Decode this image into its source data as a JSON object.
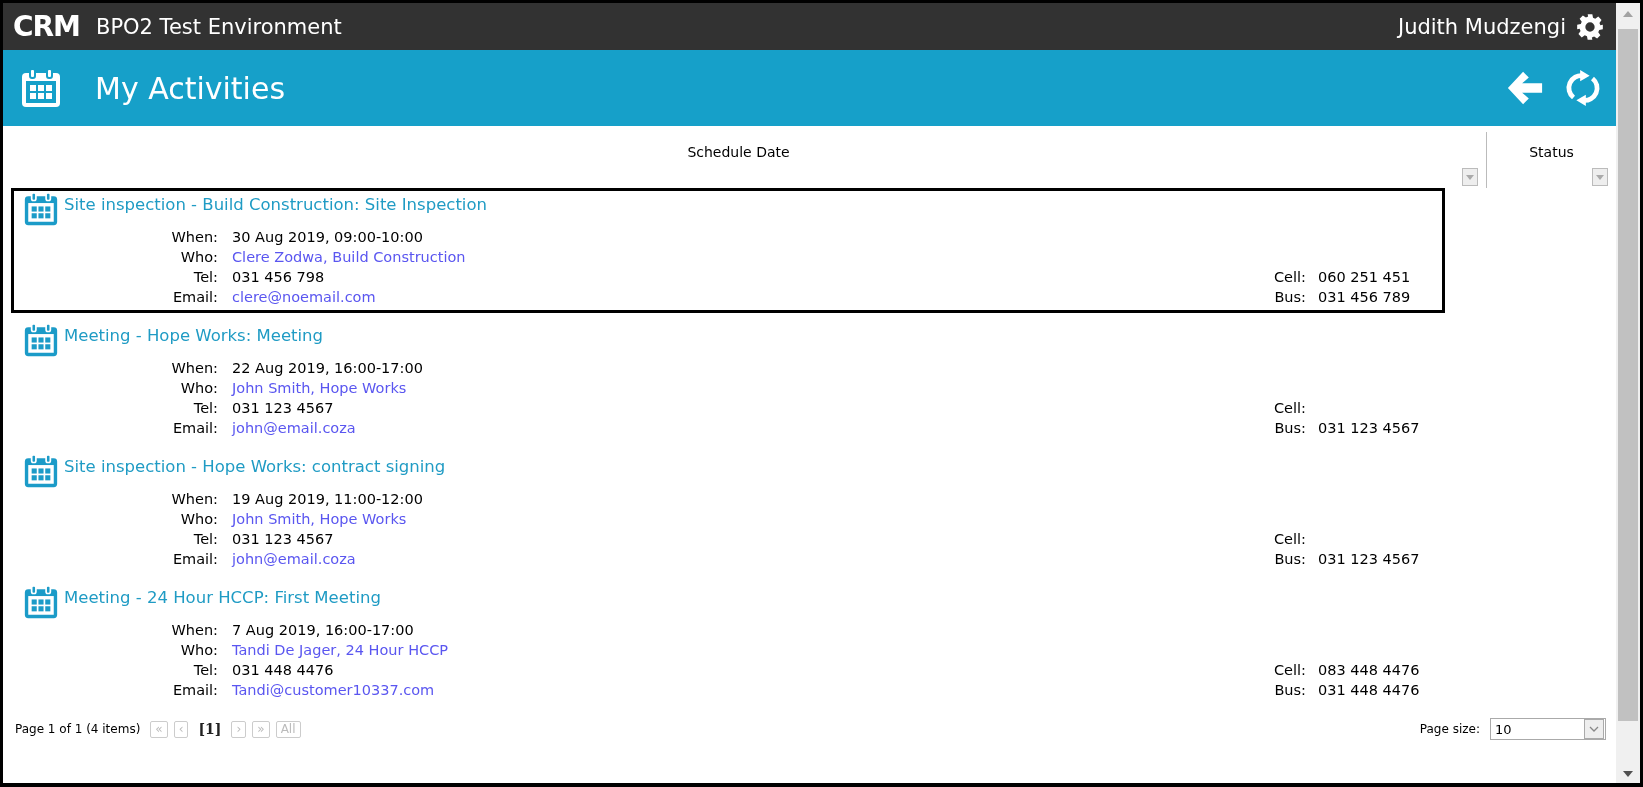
{
  "top_bar": {
    "logo": "CRM",
    "environment": "BPO2 Test Environment",
    "user": "Judith Mudzengi"
  },
  "header": {
    "title": "My Activities"
  },
  "columns": [
    {
      "label": "Schedule Date"
    },
    {
      "label": "Status"
    }
  ],
  "activities": [
    {
      "selected": true,
      "title": "Site inspection - Build Construction: Site Inspection",
      "details": [
        {
          "kind": "text",
          "label": "When:",
          "value": "30 Aug 2019, 09:00-10:00"
        },
        {
          "kind": "link",
          "label": "Who:",
          "value": "Clere Zodwa, Build Construction"
        },
        {
          "kind": "text",
          "label": "Tel:",
          "value": "031 456 798"
        },
        {
          "kind": "link",
          "label": "Email:",
          "value": "clere@noemail.com"
        }
      ],
      "phones": [
        {
          "label": "Cell:",
          "value": "060 251 451"
        },
        {
          "label": "Bus:",
          "value": "031 456 789"
        }
      ]
    },
    {
      "selected": false,
      "title": "Meeting - Hope Works: Meeting",
      "details": [
        {
          "kind": "text",
          "label": "When:",
          "value": "22 Aug 2019, 16:00-17:00"
        },
        {
          "kind": "link",
          "label": "Who:",
          "value": "John Smith, Hope Works"
        },
        {
          "kind": "text",
          "label": "Tel:",
          "value": "031 123 4567"
        },
        {
          "kind": "link",
          "label": "Email:",
          "value": "john@email.coza"
        }
      ],
      "phones": [
        {
          "label": "Cell:"
        },
        {
          "label": "Bus:",
          "value": "031 123 4567"
        }
      ]
    },
    {
      "selected": false,
      "title": "Site inspection - Hope Works: contract signing",
      "details": [
        {
          "kind": "text",
          "label": "When:",
          "value": "19 Aug 2019, 11:00-12:00"
        },
        {
          "kind": "link",
          "label": "Who:",
          "value": "John Smith, Hope Works"
        },
        {
          "kind": "text",
          "label": "Tel:",
          "value": "031 123 4567"
        },
        {
          "kind": "link",
          "label": "Email:",
          "value": "john@email.coza"
        }
      ],
      "phones": [
        {
          "label": "Cell:"
        },
        {
          "label": "Bus:",
          "value": "031 123 4567"
        }
      ]
    },
    {
      "selected": false,
      "title": "Meeting - 24 Hour HCCP: First Meeting",
      "details": [
        {
          "kind": "text",
          "label": "When:",
          "value": "7 Aug 2019, 16:00-17:00"
        },
        {
          "kind": "link",
          "label": "Who:",
          "value": "Tandi De Jager, 24 Hour HCCP"
        },
        {
          "kind": "text",
          "label": "Tel:",
          "value": "031 448 4476"
        },
        {
          "kind": "link",
          "label": "Email:",
          "value": "Tandi@customer10337.com"
        }
      ],
      "phones": [
        {
          "label": "Cell:",
          "value": "083 448 4476"
        },
        {
          "label": "Bus:",
          "value": "031 448 4476"
        }
      ]
    }
  ],
  "pager": {
    "summary": "Page 1 of 1 (4 items)",
    "buttons": [
      {
        "label": "«",
        "kind": "nav",
        "disabled": true
      },
      {
        "label": "‹",
        "kind": "nav",
        "disabled": true
      },
      {
        "label": "[1]",
        "kind": "page",
        "disabled": false
      },
      {
        "label": "›",
        "kind": "nav",
        "disabled": true
      },
      {
        "label": "»",
        "kind": "nav",
        "disabled": true
      },
      {
        "label": "All",
        "kind": "nav",
        "disabled": true
      }
    ],
    "page_size_label": "Page size:",
    "page_size": "10"
  }
}
